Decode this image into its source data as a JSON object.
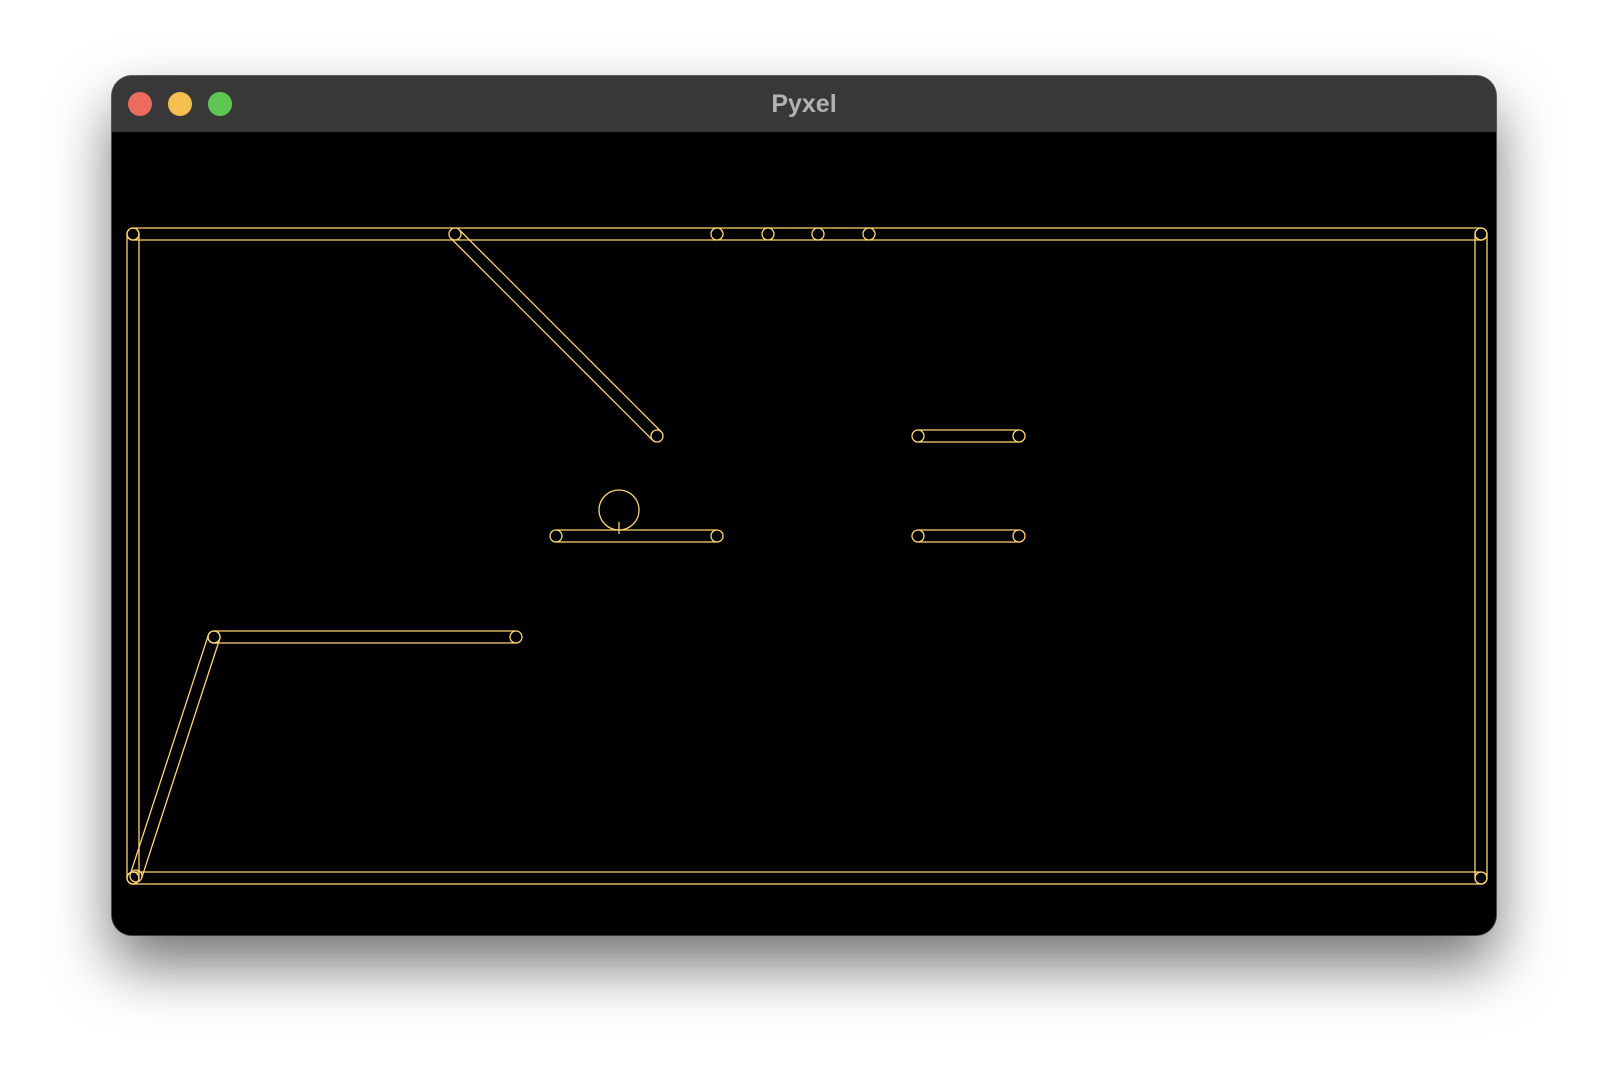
{
  "window": {
    "title": "Pyxel",
    "buttons": [
      "close",
      "minimize",
      "zoom"
    ],
    "traffic_colors": {
      "close": "#ed6a5e",
      "minimize": "#f5bf4f",
      "zoom": "#61c554"
    }
  },
  "game": {
    "background": "#000000",
    "line_color": "#ffd470",
    "objects": [
      "outer-boundary-frame",
      "diagonal-ramp-top-left",
      "top-notch-markers",
      "platform-right-upper",
      "ball",
      "platform-center",
      "platform-right-lower",
      "ledge-lower-left",
      "slope-lower-left"
    ]
  }
}
